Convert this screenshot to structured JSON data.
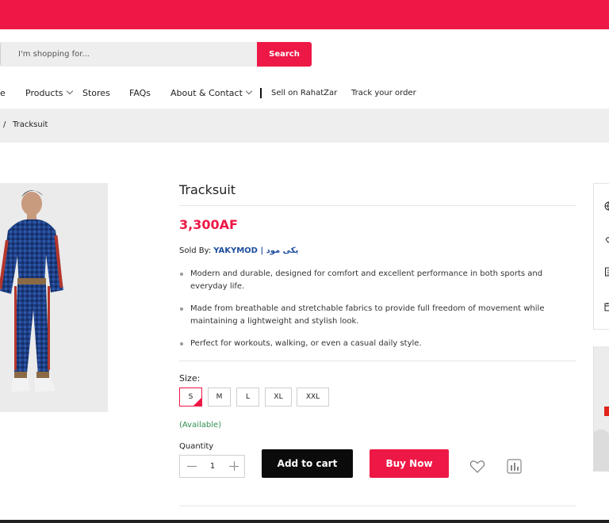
{
  "search": {
    "placeholder": "I'm shopping for...",
    "button_label": "Search"
  },
  "nav": {
    "items": [
      {
        "label": "e"
      },
      {
        "label": "Products"
      },
      {
        "label": "Stores"
      },
      {
        "label": "FAQs"
      },
      {
        "label": "About & Contact"
      },
      {
        "label": "Sell on RahatZar"
      },
      {
        "label": "Track your order"
      }
    ]
  },
  "breadcrumb": {
    "separator": "/",
    "current": "Tracksuit"
  },
  "product": {
    "title": "Tracksuit",
    "price": "3,300AF",
    "sold_by_label": "Sold By:",
    "vendor": "YAKYMOD | یکی مود",
    "features": [
      "Modern and durable, designed for comfort and excellent performance in both sports and everyday life.",
      "Made from breathable and stretchable fabrics to provide full freedom of movement while maintaining a lightweight and stylish look.",
      "Perfect for workouts, walking, or even a casual daily style."
    ],
    "size_label": "Size:",
    "sizes": [
      "S",
      "M",
      "L",
      "XL",
      "XXL"
    ],
    "selected_size": "S",
    "availability": "(Available)",
    "quantity_label": "Quantity",
    "quantity": "1",
    "add_to_cart_label": "Add to cart",
    "buy_now_label": "Buy Now"
  },
  "icons": {
    "wishlist": "heart-icon",
    "compare": "compare-icon",
    "side": [
      "globe-icon",
      "hand-icon",
      "document-icon",
      "calendar-icon"
    ]
  },
  "colors": {
    "accent": "#ee1846",
    "vendor": "#1d4e9e",
    "available": "#2f8f4f",
    "dark_button": "#0b0b0b"
  }
}
